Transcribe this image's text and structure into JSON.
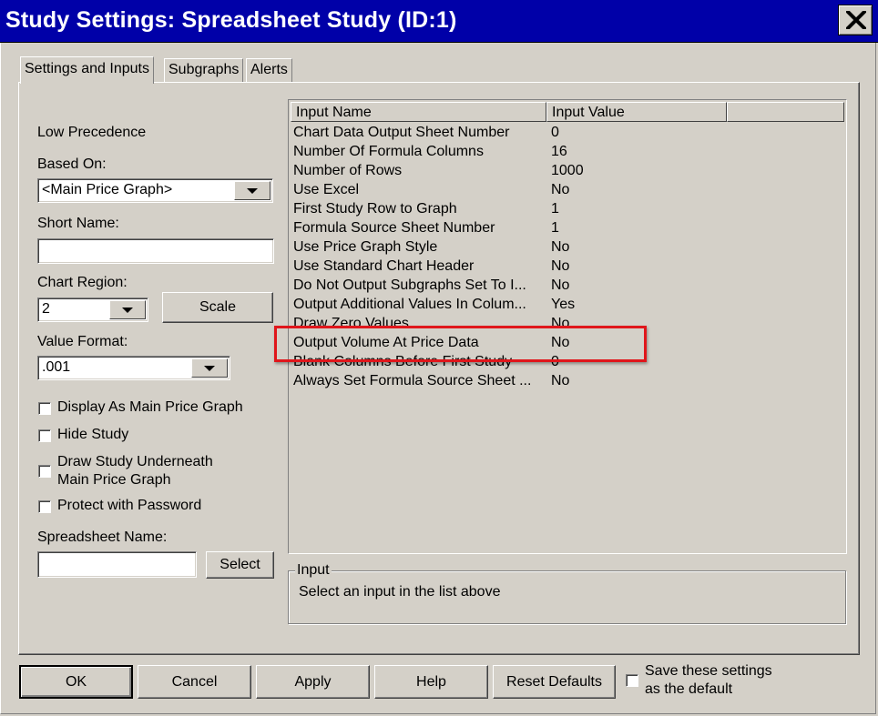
{
  "window": {
    "title": "Study Settings: Spreadsheet Study (ID:1)"
  },
  "tabs": [
    {
      "label": "Settings and Inputs"
    },
    {
      "label": "Subgraphs"
    },
    {
      "label": "Alerts"
    }
  ],
  "left": {
    "precedence": "Low Precedence",
    "based_on_label": "Based On:",
    "based_on_value": "<Main Price Graph>",
    "short_name_label": "Short Name:",
    "short_name_value": "",
    "chart_region_label": "Chart Region:",
    "chart_region_value": "2",
    "scale_button": "Scale",
    "value_format_label": "Value Format:",
    "value_format_value": ".001",
    "checkboxes": [
      {
        "label": "Display As Main Price Graph",
        "checked": false
      },
      {
        "label": "Hide Study",
        "checked": false
      },
      {
        "label": "Draw Study Underneath",
        "label2": "Main Price Graph",
        "checked": false
      },
      {
        "label": "Protect with Password",
        "checked": false
      }
    ],
    "spreadsheet_name_label": "Spreadsheet Name:",
    "spreadsheet_name_value": "",
    "select_button": "Select"
  },
  "inputs_table": {
    "columns": [
      "Input Name",
      "Input Value",
      ""
    ],
    "rows": [
      {
        "name": "Chart Data Output Sheet Number",
        "value": "0"
      },
      {
        "name": "Number Of Formula Columns",
        "value": "16"
      },
      {
        "name": "Number of Rows",
        "value": "1000"
      },
      {
        "name": "Use Excel",
        "value": "No"
      },
      {
        "name": "First Study Row to Graph",
        "value": "1"
      },
      {
        "name": "Formula Source Sheet Number",
        "value": "1"
      },
      {
        "name": "Use Price Graph Style",
        "value": "No"
      },
      {
        "name": "Use Standard Chart Header",
        "value": "No"
      },
      {
        "name": "Do Not Output Subgraphs Set To I...",
        "value": "No"
      },
      {
        "name": "Output Additional Values In Colum...",
        "value": "Yes"
      },
      {
        "name": "Draw Zero Values",
        "value": "No"
      },
      {
        "name": "Output Volume At Price Data",
        "value": "No"
      },
      {
        "name": "Blank Columns Before First Study",
        "value": "0"
      },
      {
        "name": "Always Set Formula Source Sheet ...",
        "value": "No"
      }
    ]
  },
  "input_box": {
    "legend": "Input",
    "text": "Select an input in the list above"
  },
  "footer": {
    "ok": "OK",
    "cancel": "Cancel",
    "apply": "Apply",
    "help": "Help",
    "reset": "Reset Defaults",
    "save_default_line1": "Save these settings",
    "save_default_line2": "as the default"
  },
  "colors": {
    "titlebar": "#0000a8",
    "face": "#d4d0c8",
    "highlight": "#e0161b"
  }
}
